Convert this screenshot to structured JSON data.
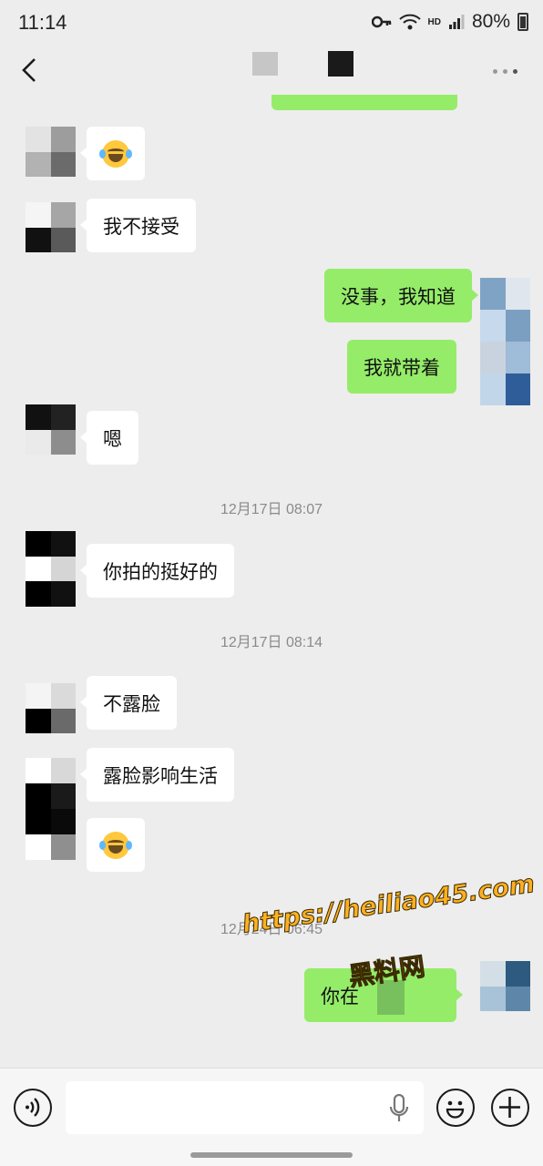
{
  "status_bar": {
    "time": "11:14",
    "hd_label": "HD",
    "battery": "80%"
  },
  "nav": {
    "back_icon": "chevron-left-icon",
    "more_icon": "more-dots-icon"
  },
  "messages": [
    {
      "side": "in",
      "type": "emoji",
      "emoji": "face-with-tears-of-joy"
    },
    {
      "side": "in",
      "text": "我不接受"
    },
    {
      "side": "out",
      "text": "没事，我知道"
    },
    {
      "side": "out",
      "text": "我就带着"
    },
    {
      "side": "in",
      "text": "嗯"
    },
    {
      "type": "timestamp",
      "text": "12月17日 08:07"
    },
    {
      "side": "in",
      "text": "你拍的挺好的"
    },
    {
      "type": "timestamp",
      "text": "12月17日 08:14"
    },
    {
      "side": "in",
      "text": "不露脸"
    },
    {
      "side": "in",
      "text": "露脸影响生活"
    },
    {
      "side": "in",
      "type": "emoji",
      "emoji": "face-with-tears-of-joy"
    },
    {
      "type": "timestamp",
      "text": "12月24日 06:45"
    },
    {
      "side": "out",
      "text": "你在"
    }
  ],
  "watermark": {
    "url": "https://heiliao45.com",
    "name": "黑料网"
  },
  "input_bar": {
    "placeholder": "",
    "icons": [
      "voice-icon",
      "mic-icon",
      "emoji-icon",
      "plus-icon"
    ]
  },
  "colors": {
    "background": "#ededed",
    "bubble_out": "#95ec69",
    "bubble_in": "#ffffff",
    "watermark": "#ffb020"
  }
}
